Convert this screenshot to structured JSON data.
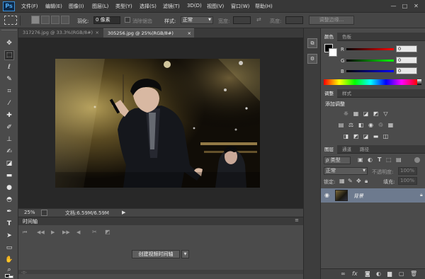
{
  "app": {
    "logo": "Ps"
  },
  "menu": [
    "文件(F)",
    "编辑(E)",
    "图像(I)",
    "图层(L)",
    "类型(Y)",
    "选择(S)",
    "滤镜(T)",
    "3D(D)",
    "视图(V)",
    "窗口(W)",
    "帮助(H)"
  ],
  "window_controls": [
    "—",
    "□",
    "✕"
  ],
  "options": {
    "feather_label": "羽化:",
    "feather_value": "0 像素",
    "antialias_label": "消除锯齿",
    "style_label": "样式:",
    "style_value": "正常",
    "width_label": "宽度:",
    "height_label": "高度:",
    "refine_edge": "调整边缘..."
  },
  "doc_tabs": [
    {
      "label": "317276.jpg @ 33.3%(RGB/8#)",
      "close": "×"
    },
    {
      "label": "305256.jpg @ 25%(RGB/8#)",
      "close": "×"
    }
  ],
  "status": {
    "zoom": "25%",
    "doc_info": "文档:6.59M/6.59M",
    "arrow": "▶"
  },
  "timeline": {
    "title": "时间轴",
    "create_button": "创建视频时间轴"
  },
  "color_panel": {
    "tabs": [
      "颜色",
      "色板"
    ],
    "channels": [
      {
        "label": "R",
        "value": "0",
        "color": "#e02020"
      },
      {
        "label": "G",
        "value": "0",
        "color": "#20c020"
      },
      {
        "label": "B",
        "value": "0",
        "color": "#2040e0"
      }
    ]
  },
  "adjust_panel": {
    "tabs": [
      "调整",
      "样式"
    ],
    "title": "添加调整",
    "row1_icons": [
      "brightness-icon",
      "levels-icon",
      "curves-icon",
      "exposure-icon",
      "vibrance-icon"
    ],
    "row2_icons": [
      "hue-saturation-icon",
      "color-balance-icon",
      "black-white-icon",
      "photo-filter-icon",
      "channel-mixer-icon",
      "color-lookup-icon"
    ],
    "row3_icons": [
      "invert-icon",
      "posterize-icon",
      "threshold-icon",
      "selective-color-icon",
      "gradient-map-icon"
    ]
  },
  "layers_panel": {
    "tabs": [
      "图层",
      "通道",
      "路径"
    ],
    "filter_label": "ρ 类型",
    "blend_mode": "正常",
    "opacity_label": "不透明度:",
    "opacity_value": "100%",
    "lock_label": "锁定:",
    "fill_label": "填充:",
    "fill_value": "100%",
    "layer_name": "背景",
    "bottom_icons": [
      "link-icon",
      "fx-icon",
      "mask-icon",
      "adjustment-icon",
      "folder-icon",
      "new-layer-icon",
      "trash-icon"
    ]
  }
}
